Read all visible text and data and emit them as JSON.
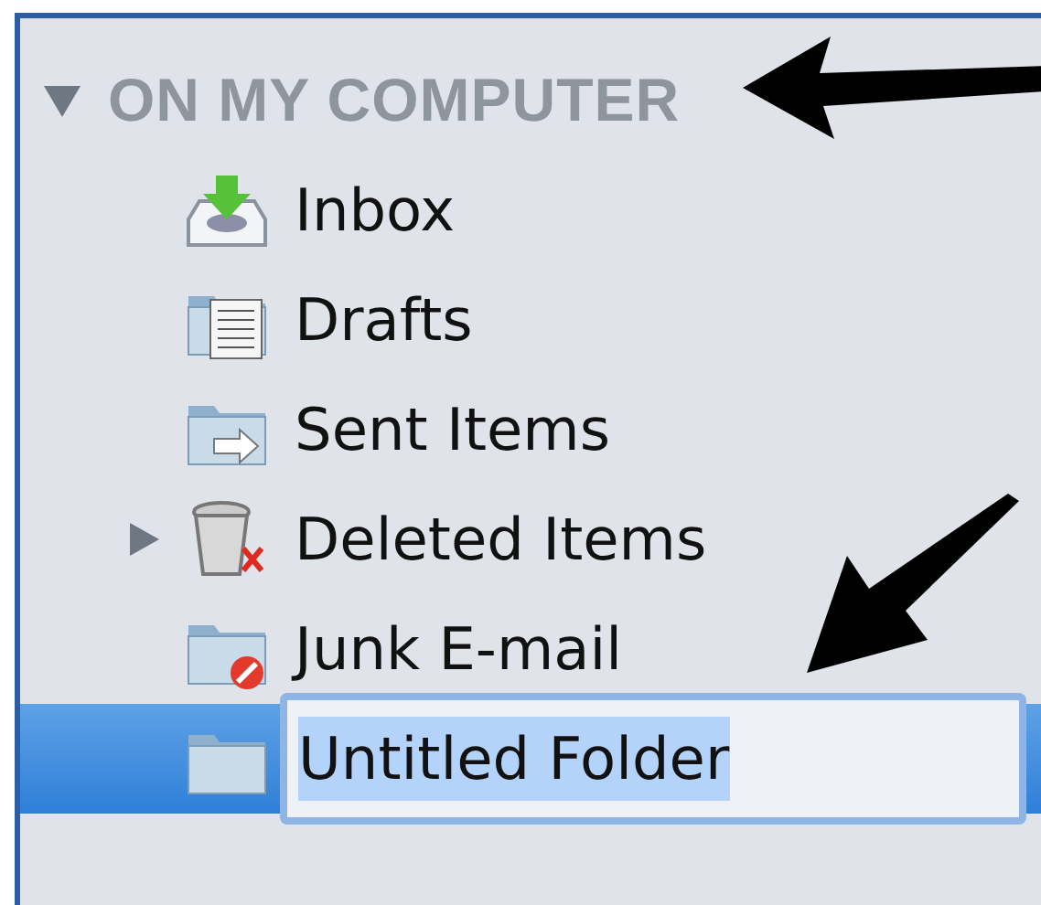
{
  "sidebar": {
    "section": {
      "label": "ON MY COMPUTER",
      "expanded": true
    },
    "folders": [
      {
        "name": "Inbox",
        "kind": "inbox",
        "expandable": false,
        "selected": false,
        "editing": false
      },
      {
        "name": "Drafts",
        "kind": "drafts",
        "expandable": false,
        "selected": false,
        "editing": false
      },
      {
        "name": "Sent Items",
        "kind": "sent",
        "expandable": false,
        "selected": false,
        "editing": false
      },
      {
        "name": "Deleted Items",
        "kind": "deleted",
        "expandable": true,
        "selected": false,
        "editing": false
      },
      {
        "name": "Junk E-mail",
        "kind": "junk",
        "expandable": false,
        "selected": false,
        "editing": false
      },
      {
        "name": "Untitled Folder",
        "kind": "folder",
        "expandable": false,
        "selected": true,
        "editing": true
      }
    ]
  }
}
